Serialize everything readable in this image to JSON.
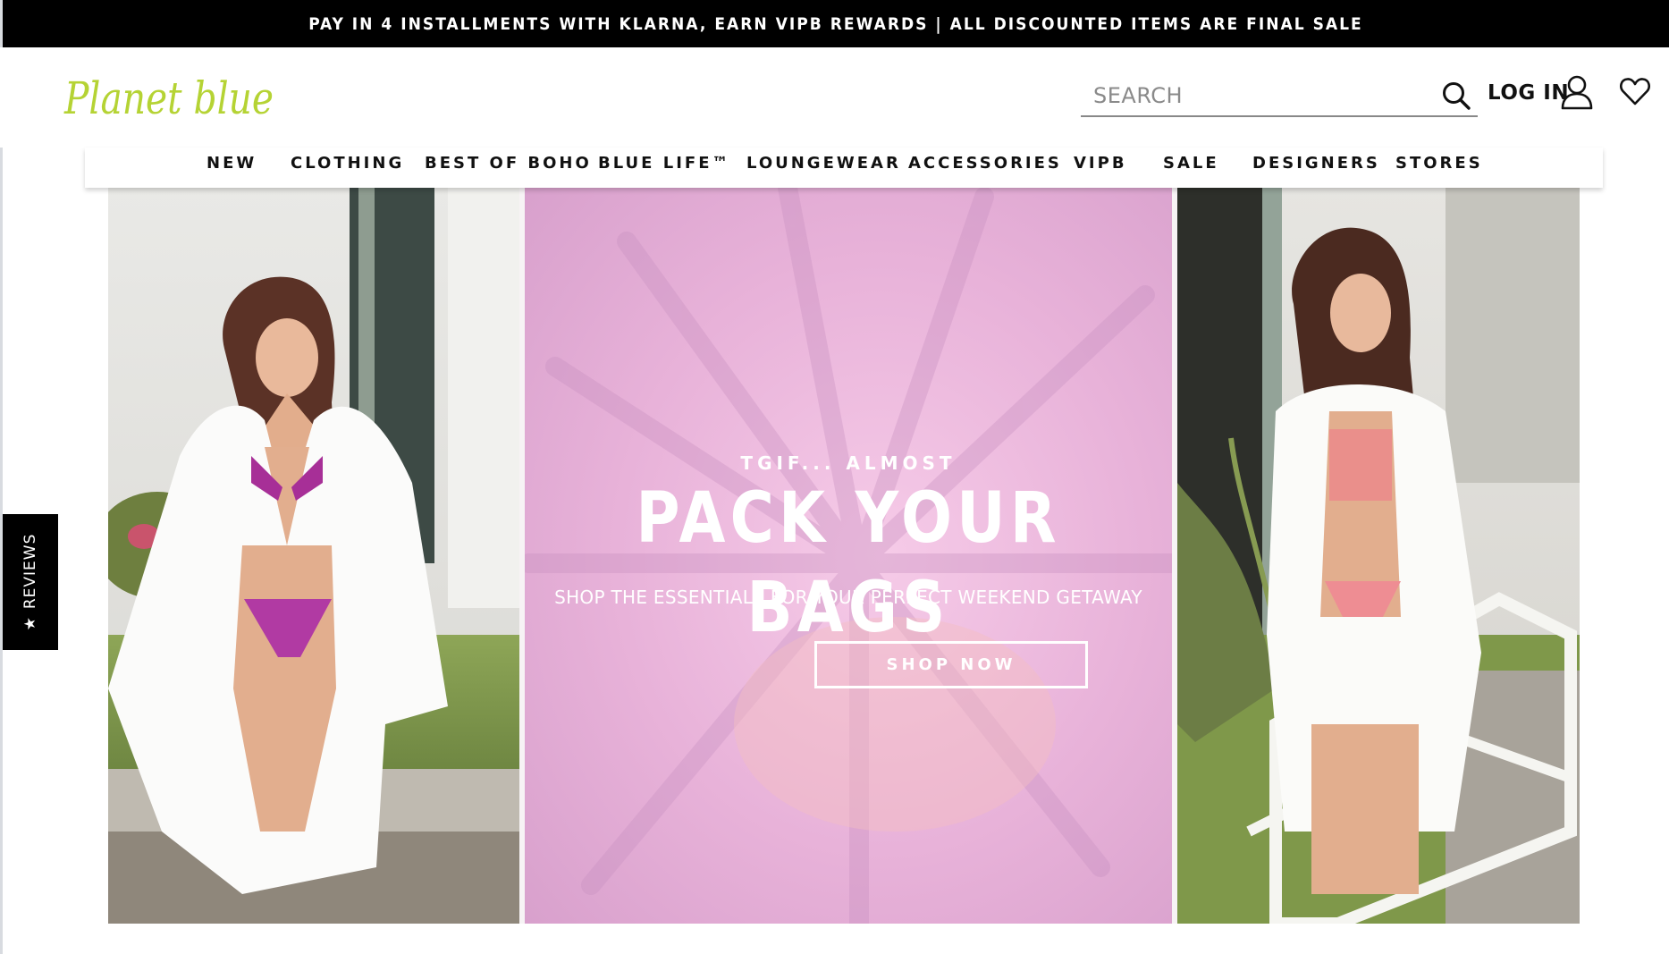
{
  "promo": {
    "text": "PAY IN 4 INSTALLMENTS WITH KLARNA, EARN VIPB REWARDS | ALL DISCOUNTED ITEMS ARE FINAL SALE"
  },
  "header": {
    "logo_text": "Planet blue",
    "search_placeholder": "SEARCH",
    "login_label": "LOG IN"
  },
  "nav": {
    "items": [
      {
        "label": "NEW"
      },
      {
        "label": "CLOTHING"
      },
      {
        "label": "BEST OF BOHO"
      },
      {
        "label": "BLUE LIFE™"
      },
      {
        "label": "LOUNGEWEAR"
      },
      {
        "label": "ACCESSORIES"
      },
      {
        "label": "VIPB"
      },
      {
        "label": "SALE"
      },
      {
        "label": "DESIGNERS"
      },
      {
        "label": "STORES"
      }
    ]
  },
  "hero": {
    "eyebrow": "TGIF... ALMOST",
    "headline": "PACK YOUR BAGS",
    "subhead": "SHOP THE ESSENTIALS FOR YOUR PERFECT WEEKEND GETAWAY",
    "cta_label": "SHOP NOW"
  },
  "reviews_tab": {
    "label": "REVIEWS"
  },
  "colors": {
    "logo_green": "#b5d334",
    "promo_bg": "#000000",
    "hero_pink": "#e9b4d9"
  },
  "icons": [
    "search-icon",
    "account-icon",
    "heart-icon",
    "star-icon"
  ]
}
